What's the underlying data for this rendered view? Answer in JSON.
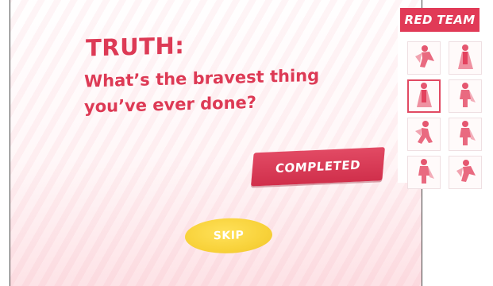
{
  "card": {
    "title": "TRUTH:",
    "question": "What’s the bravest thing you’ve ever done?"
  },
  "buttons": {
    "completed": "COMPLETED",
    "skip": "SKIP"
  },
  "team": {
    "name": "RED TEAM",
    "color": "#e13a57",
    "heroes": [
      {
        "icon": "flying-hero-icon",
        "selected": false
      },
      {
        "icon": "caped-hero-icon",
        "selected": false
      },
      {
        "icon": "caped-hero-icon",
        "selected": true
      },
      {
        "icon": "hero-icon",
        "selected": false
      },
      {
        "icon": "running-hero-icon",
        "selected": false
      },
      {
        "icon": "hero-icon",
        "selected": false
      },
      {
        "icon": "hero-icon",
        "selected": false
      },
      {
        "icon": "flying-hero-icon",
        "selected": false
      }
    ]
  },
  "colors": {
    "accent": "#dd3a55",
    "skip": "#f8d23a"
  }
}
